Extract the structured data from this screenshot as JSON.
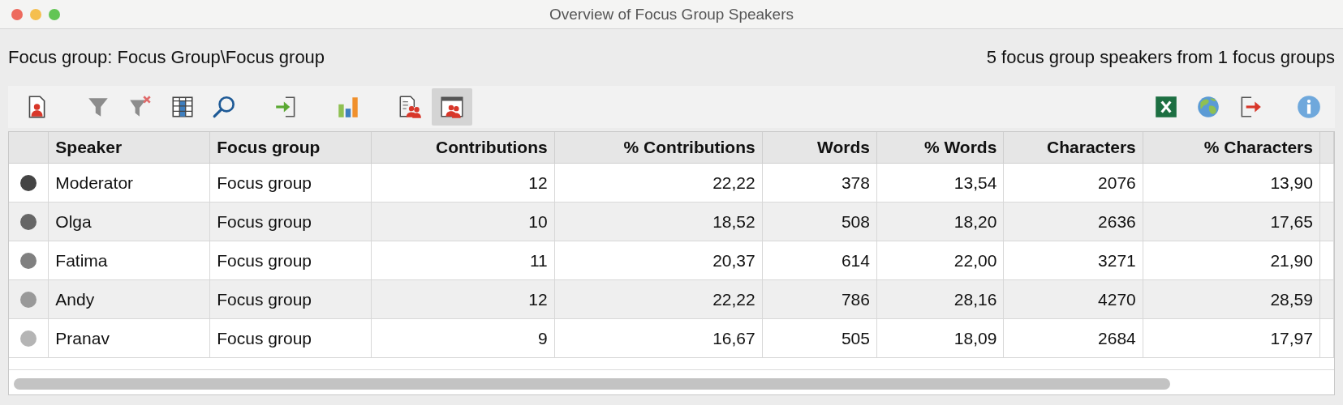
{
  "window": {
    "title": "Overview of Focus Group Speakers"
  },
  "header": {
    "focus_group": "Focus group: Focus Group\\Focus group",
    "summary": "5 focus group speakers from 1 focus groups"
  },
  "toolbar": [
    {
      "kind": "speaker-doc",
      "selected": false
    },
    {
      "kind": "filter",
      "selected": false
    },
    {
      "kind": "filter-clear",
      "selected": false
    },
    {
      "kind": "columns",
      "selected": false
    },
    {
      "kind": "search",
      "selected": false
    },
    {
      "kind": "import",
      "selected": false
    },
    {
      "kind": "chart",
      "selected": false
    },
    {
      "kind": "speakers-doc",
      "selected": false
    },
    {
      "kind": "speakers-window",
      "selected": true
    },
    {
      "kind": "excel",
      "selected": false
    },
    {
      "kind": "globe",
      "selected": false
    },
    {
      "kind": "export",
      "selected": false
    },
    {
      "kind": "info",
      "selected": false
    }
  ],
  "table": {
    "columns": [
      "Speaker",
      "Focus group",
      "Contributions",
      "% Contributions",
      "Words",
      "% Words",
      "Characters",
      "% Characters"
    ],
    "rows": [
      {
        "color": "#444444",
        "cells": [
          "Moderator",
          "Focus group",
          "12",
          "22,22",
          "378",
          "13,54",
          "2076",
          "13,90"
        ]
      },
      {
        "color": "#666666",
        "cells": [
          "Olga",
          "Focus group",
          "10",
          "18,52",
          "508",
          "18,20",
          "2636",
          "17,65"
        ]
      },
      {
        "color": "#808080",
        "cells": [
          "Fatima",
          "Focus group",
          "11",
          "20,37",
          "614",
          "22,00",
          "3271",
          "21,90"
        ]
      },
      {
        "color": "#999999",
        "cells": [
          "Andy",
          "Focus group",
          "12",
          "22,22",
          "786",
          "28,16",
          "4270",
          "28,59"
        ]
      },
      {
        "color": "#b5b5b5",
        "cells": [
          "Pranav",
          "Focus group",
          "9",
          "16,67",
          "505",
          "18,09",
          "2684",
          "17,97"
        ]
      }
    ]
  }
}
